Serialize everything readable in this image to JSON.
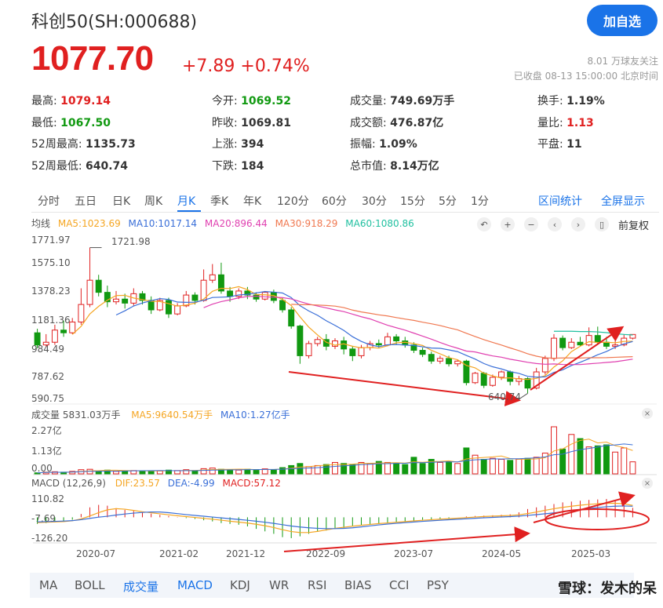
{
  "header": {
    "title": "科创50(SH:000688)",
    "follow_label": "加自选",
    "price": "1077.70",
    "change": "+7.89  +0.74%",
    "followers": "8.01 万球友关注",
    "status": "已收盘 08-13 15:00:00 北京时间"
  },
  "quote": {
    "high": {
      "label": "最高:",
      "value": "1079.14"
    },
    "low": {
      "label": "最低:",
      "value": "1067.50"
    },
    "high52": {
      "label": "52周最高:",
      "value": "1135.73"
    },
    "low52": {
      "label": "52周最低:",
      "value": "640.74"
    },
    "open": {
      "label": "今开:",
      "value": "1069.52"
    },
    "prev_close": {
      "label": "昨收:",
      "value": "1069.81"
    },
    "up": {
      "label": "上涨:",
      "value": "394"
    },
    "down": {
      "label": "下跌:",
      "value": "184"
    },
    "volume": {
      "label": "成交量:",
      "value": "749.69万手"
    },
    "turnover": {
      "label": "成交额:",
      "value": "476.87亿"
    },
    "amplitude": {
      "label": "振幅:",
      "value": "1.09%"
    },
    "mktcap": {
      "label": "总市值:",
      "value": "8.14万亿"
    },
    "turnover_rate": {
      "label": "换手:",
      "value": "1.19%"
    },
    "vol_ratio": {
      "label": "量比:",
      "value": "1.13"
    },
    "flat": {
      "label": "平盘:",
      "value": "11"
    }
  },
  "tabs": [
    "分时",
    "五日",
    "日K",
    "周K",
    "月K",
    "季K",
    "年K",
    "120分",
    "60分",
    "30分",
    "15分",
    "5分",
    "1分"
  ],
  "active_tab": "月K",
  "tab_links": {
    "range": "区间统计",
    "fullscreen": "全屏显示"
  },
  "ma": {
    "label": "均线",
    "ma5": "MA5:1023.69",
    "ma10": "MA10:1017.14",
    "ma20": "MA20:896.44",
    "ma30": "MA30:918.29",
    "ma60": "MA60:1080.86",
    "adjust": "前复权"
  },
  "colors": {
    "up": "#e02020",
    "down": "#119911",
    "ma5": "#f5a623",
    "ma10": "#3a6fd8",
    "ma20": "#e040b0",
    "ma30": "#f07850",
    "ma60": "#20c0a0",
    "accent": "#1a73e8"
  },
  "price_axis": [
    "1771.97",
    "1575.10",
    "1378.23",
    "1181.36",
    "984.49",
    "787.62",
    "590.75"
  ],
  "annotations": {
    "high": "1721.98",
    "low": "640.74"
  },
  "volume": {
    "header": "成交量 5831.03万手",
    "ma5": "MA5:9640.54万手",
    "ma10": "MA10:1.27亿手",
    "axis": [
      "2.27亿",
      "1.13亿",
      "0.00"
    ]
  },
  "macd": {
    "header": "MACD (12,26,9)",
    "dif": "DIF:23.57",
    "dea": "DEA:-4.99",
    "macd": "MACD:57.12",
    "axis": [
      "110.82",
      "-7.69",
      "-126.20"
    ]
  },
  "x_axis": [
    "2020-07",
    "2021-02",
    "2021-12",
    "2022-09",
    "2023-07",
    "2024-05",
    "2025-03"
  ],
  "indicators": [
    "MA",
    "BOLL",
    "成交量",
    "MACD",
    "KDJ",
    "WR",
    "RSI",
    "BIAS",
    "CCI",
    "PSY"
  ],
  "active_indicators": [
    "成交量",
    "MACD"
  ],
  "watermark": "雪球：发木的呆",
  "chart_data": {
    "type": "candlestick",
    "period": "monthly",
    "ylim": [
      590.75,
      1771.97
    ],
    "candles": [
      {
        "o": 1090,
        "c": 1000,
        "h": 1120,
        "l": 975
      },
      {
        "o": 1000,
        "c": 1020,
        "h": 1080,
        "l": 990
      },
      {
        "o": 1020,
        "c": 1110,
        "h": 1150,
        "l": 1000
      },
      {
        "o": 1110,
        "c": 1090,
        "h": 1180,
        "l": 1060
      },
      {
        "o": 1090,
        "c": 1170,
        "h": 1200,
        "l": 1080
      },
      {
        "o": 1170,
        "c": 1300,
        "h": 1420,
        "l": 1150
      },
      {
        "o": 1300,
        "c": 1480,
        "h": 1721.98,
        "l": 1280
      },
      {
        "o": 1480,
        "c": 1390,
        "h": 1520,
        "l": 1360
      },
      {
        "o": 1390,
        "c": 1320,
        "h": 1440,
        "l": 1280
      },
      {
        "o": 1320,
        "c": 1340,
        "h": 1400,
        "l": 1300
      },
      {
        "o": 1340,
        "c": 1310,
        "h": 1380,
        "l": 1270
      },
      {
        "o": 1310,
        "c": 1380,
        "h": 1420,
        "l": 1290
      },
      {
        "o": 1380,
        "c": 1330,
        "h": 1400,
        "l": 1300
      },
      {
        "o": 1330,
        "c": 1260,
        "h": 1360,
        "l": 1230
      },
      {
        "o": 1260,
        "c": 1330,
        "h": 1350,
        "l": 1250
      },
      {
        "o": 1330,
        "c": 1230,
        "h": 1350,
        "l": 1200
      },
      {
        "o": 1230,
        "c": 1290,
        "h": 1310,
        "l": 1220
      },
      {
        "o": 1290,
        "c": 1370,
        "h": 1400,
        "l": 1280
      },
      {
        "o": 1370,
        "c": 1330,
        "h": 1390,
        "l": 1300
      },
      {
        "o": 1330,
        "c": 1480,
        "h": 1560,
        "l": 1320
      },
      {
        "o": 1480,
        "c": 1520,
        "h": 1600,
        "l": 1460
      },
      {
        "o": 1520,
        "c": 1400,
        "h": 1610,
        "l": 1380
      },
      {
        "o": 1400,
        "c": 1360,
        "h": 1430,
        "l": 1320
      },
      {
        "o": 1360,
        "c": 1400,
        "h": 1420,
        "l": 1340
      },
      {
        "o": 1400,
        "c": 1370,
        "h": 1430,
        "l": 1340
      },
      {
        "o": 1370,
        "c": 1340,
        "h": 1390,
        "l": 1320
      },
      {
        "o": 1340,
        "c": 1390,
        "h": 1400,
        "l": 1330
      },
      {
        "o": 1390,
        "c": 1330,
        "h": 1410,
        "l": 1310
      },
      {
        "o": 1330,
        "c": 1260,
        "h": 1350,
        "l": 1240
      },
      {
        "o": 1260,
        "c": 1140,
        "h": 1280,
        "l": 1120
      },
      {
        "o": 1140,
        "c": 920,
        "h": 1150,
        "l": 860
      },
      {
        "o": 920,
        "c": 1010,
        "h": 1030,
        "l": 900
      },
      {
        "o": 1010,
        "c": 1040,
        "h": 1060,
        "l": 990
      },
      {
        "o": 1040,
        "c": 990,
        "h": 1080,
        "l": 960
      },
      {
        "o": 990,
        "c": 1030,
        "h": 1050,
        "l": 970
      },
      {
        "o": 1030,
        "c": 970,
        "h": 1060,
        "l": 930
      },
      {
        "o": 970,
        "c": 920,
        "h": 990,
        "l": 880
      },
      {
        "o": 920,
        "c": 980,
        "h": 1000,
        "l": 900
      },
      {
        "o": 980,
        "c": 1010,
        "h": 1030,
        "l": 960
      },
      {
        "o": 1010,
        "c": 1000,
        "h": 1040,
        "l": 980
      },
      {
        "o": 1000,
        "c": 1060,
        "h": 1090,
        "l": 990
      },
      {
        "o": 1060,
        "c": 1030,
        "h": 1080,
        "l": 1000
      },
      {
        "o": 1030,
        "c": 1000,
        "h": 1060,
        "l": 980
      },
      {
        "o": 1000,
        "c": 960,
        "h": 1020,
        "l": 940
      },
      {
        "o": 960,
        "c": 930,
        "h": 980,
        "l": 910
      },
      {
        "o": 930,
        "c": 880,
        "h": 950,
        "l": 860
      },
      {
        "o": 880,
        "c": 900,
        "h": 920,
        "l": 860
      },
      {
        "o": 900,
        "c": 860,
        "h": 920,
        "l": 840
      },
      {
        "o": 860,
        "c": 880,
        "h": 890,
        "l": 840
      },
      {
        "o": 880,
        "c": 720,
        "h": 890,
        "l": 700
      },
      {
        "o": 720,
        "c": 790,
        "h": 800,
        "l": 710
      },
      {
        "o": 790,
        "c": 700,
        "h": 800,
        "l": 680
      },
      {
        "o": 700,
        "c": 760,
        "h": 780,
        "l": 690
      },
      {
        "o": 760,
        "c": 800,
        "h": 810,
        "l": 740
      },
      {
        "o": 800,
        "c": 730,
        "h": 810,
        "l": 700
      },
      {
        "o": 730,
        "c": 750,
        "h": 770,
        "l": 700
      },
      {
        "o": 750,
        "c": 680,
        "h": 760,
        "l": 640.74
      },
      {
        "o": 680,
        "c": 800,
        "h": 830,
        "l": 670
      },
      {
        "o": 800,
        "c": 900,
        "h": 920,
        "l": 780
      },
      {
        "o": 900,
        "c": 1050,
        "h": 1080,
        "l": 880
      },
      {
        "o": 1050,
        "c": 980,
        "h": 1070,
        "l": 960
      },
      {
        "o": 980,
        "c": 1020,
        "h": 1050,
        "l": 970
      },
      {
        "o": 1020,
        "c": 1000,
        "h": 1060,
        "l": 990
      },
      {
        "o": 1000,
        "c": 1070,
        "h": 1130,
        "l": 990
      },
      {
        "o": 1070,
        "c": 1020,
        "h": 1135.73,
        "l": 1000
      },
      {
        "o": 1020,
        "c": 990,
        "h": 1060,
        "l": 970
      },
      {
        "o": 990,
        "c": 1000,
        "h": 1030,
        "l": 970
      },
      {
        "o": 1000,
        "c": 1050,
        "h": 1080,
        "l": 990
      },
      {
        "o": 1050,
        "c": 1077.7,
        "h": 1079.14,
        "l": 1040
      }
    ],
    "volumes": [
      0.05,
      0.08,
      0.1,
      0.08,
      0.12,
      0.2,
      0.22,
      0.15,
      0.18,
      0.12,
      0.14,
      0.16,
      0.13,
      0.15,
      0.14,
      0.18,
      0.16,
      0.2,
      0.14,
      0.25,
      0.28,
      0.22,
      0.2,
      0.18,
      0.22,
      0.2,
      0.24,
      0.2,
      0.3,
      0.4,
      0.5,
      0.35,
      0.4,
      0.45,
      0.55,
      0.5,
      0.45,
      0.55,
      0.5,
      0.6,
      0.55,
      0.5,
      0.45,
      0.8,
      0.5,
      0.7,
      0.55,
      0.6,
      0.5,
      1.25,
      0.9,
      0.7,
      0.75,
      0.7,
      0.65,
      0.7,
      0.75,
      0.8,
      1.0,
      2.27,
      1.2,
      1.9,
      1.7,
      1.3,
      1.35,
      1.4,
      1.05,
      1.25,
      0.58
    ],
    "macd_hist": [
      -40,
      -35,
      -30,
      -25,
      -15,
      20,
      60,
      75,
      70,
      55,
      45,
      38,
      30,
      22,
      15,
      8,
      2,
      -5,
      -10,
      -18,
      -25,
      -35,
      -40,
      -45,
      -55,
      -70,
      -85,
      -100,
      -120,
      -126,
      -115,
      -100,
      -85,
      -80,
      -70,
      -65,
      -55,
      -50,
      -45,
      -40,
      -35,
      -30,
      -25,
      -20,
      -15,
      -12,
      -10,
      -5,
      0,
      5,
      8,
      10,
      12,
      15,
      18,
      30,
      50,
      60,
      70,
      80,
      90,
      95,
      100,
      105,
      108,
      110.82,
      100,
      90,
      57.12
    ]
  }
}
